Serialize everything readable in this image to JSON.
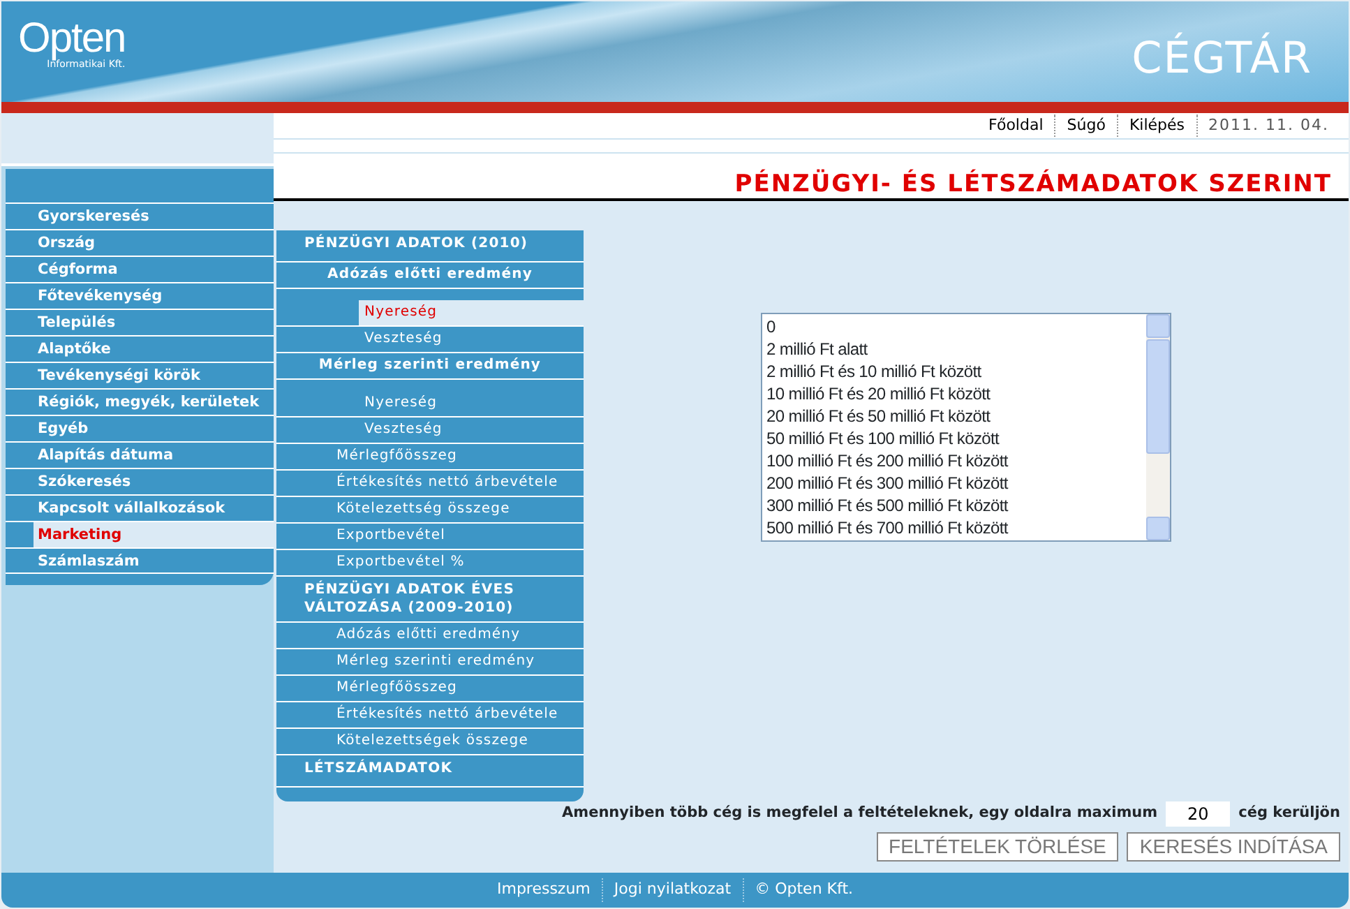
{
  "header": {
    "logo": "Opten",
    "logo_subtitle": "Informatikai Kft.",
    "title": "CÉGTÁR"
  },
  "top_nav": {
    "links": [
      "Főoldal",
      "Súgó",
      "Kilépés"
    ],
    "date": "2011. 11. 04."
  },
  "page_title": "PÉNZÜGYI- ÉS LÉTSZÁMADATOK SZERINT",
  "sidebar": {
    "items": [
      {
        "label": "Gyorskeresés",
        "selected": false
      },
      {
        "label": "Ország",
        "selected": false
      },
      {
        "label": "Cégforma",
        "selected": false
      },
      {
        "label": "Főtevékenység",
        "selected": false
      },
      {
        "label": "Település",
        "selected": false
      },
      {
        "label": "Alaptőke",
        "selected": false
      },
      {
        "label": "Tevékenységi körök",
        "selected": false
      },
      {
        "label": "Régiók, megyék, kerületek",
        "selected": false
      },
      {
        "label": "Egyéb",
        "selected": false
      },
      {
        "label": "Alapítás dátuma",
        "selected": false
      },
      {
        "label": "Szókeresés",
        "selected": false
      },
      {
        "label": "Kapcsolt vállalkozások",
        "selected": false
      },
      {
        "label": "Marketing",
        "selected": true
      },
      {
        "label": "Számlaszám",
        "selected": false
      }
    ]
  },
  "submenu": [
    {
      "label": "PÉNZÜGYI ADATOK (2010)",
      "children": [
        {
          "label": "Adózás előtti eredmény",
          "children": [
            {
              "label": "Nyereség",
              "selected": true
            },
            {
              "label": "Veszteség",
              "selected": false
            }
          ]
        },
        {
          "label": "Mérleg szerinti eredmény",
          "children": [
            {
              "label": "Nyereség",
              "selected": false
            },
            {
              "label": "Veszteség",
              "selected": false
            }
          ]
        },
        {
          "label": "Mérlegfőösszeg",
          "selected": false
        },
        {
          "label": "Értékesítés nettó árbevétele",
          "selected": false
        },
        {
          "label": "Kötelezettség összege",
          "selected": false
        },
        {
          "label": "Exportbevétel",
          "selected": false
        },
        {
          "label": "Exportbevétel %",
          "selected": false
        }
      ]
    },
    {
      "label": "PÉNZÜGYI ADATOK ÉVES VÁLTOZÁSA (2009-2010)",
      "children": [
        {
          "label": "Adózás előtti eredmény",
          "selected": false
        },
        {
          "label": "Mérleg szerinti eredmény",
          "selected": false
        },
        {
          "label": "Mérlegfőösszeg",
          "selected": false
        },
        {
          "label": "Értékesítés nettó árbevétele",
          "selected": false
        },
        {
          "label": "Kötelezettségek összege",
          "selected": false
        }
      ]
    },
    {
      "label": "LÉTSZÁMADATOK"
    }
  ],
  "listbox": {
    "options": [
      {
        "label": "0",
        "selected": false
      },
      {
        "label": "2 millió Ft alatt",
        "selected": false
      },
      {
        "label": "2 millió Ft és 10 millió Ft között",
        "selected": false
      },
      {
        "label": "10 millió Ft és 20 millió Ft között",
        "selected": false
      },
      {
        "label": "20 millió Ft és 50 millió Ft között",
        "selected": false
      },
      {
        "label": "50 millió Ft és 100 millió Ft között",
        "selected": false
      },
      {
        "label": "100 millió Ft és 200 millió Ft között",
        "selected": false
      },
      {
        "label": "200 millió Ft és 300 millió Ft között",
        "selected": false
      },
      {
        "label": "300 millió Ft és 500 millió Ft között",
        "selected": false
      },
      {
        "label": "500 millió Ft és 700 millió Ft között",
        "selected": false
      }
    ]
  },
  "page_size": {
    "label_before": "Amennyiben több cég is megfelel a feltételeknek, egy oldalra maximum",
    "value": "20",
    "label_after": "cég kerüljön"
  },
  "buttons": [
    "FELTÉTELEK TÖRLÉSE",
    "KERESÉS INDÍTÁSA"
  ],
  "footer": [
    "Impresszum",
    "Jogi nyilatkozat",
    "© Opten Kft."
  ]
}
